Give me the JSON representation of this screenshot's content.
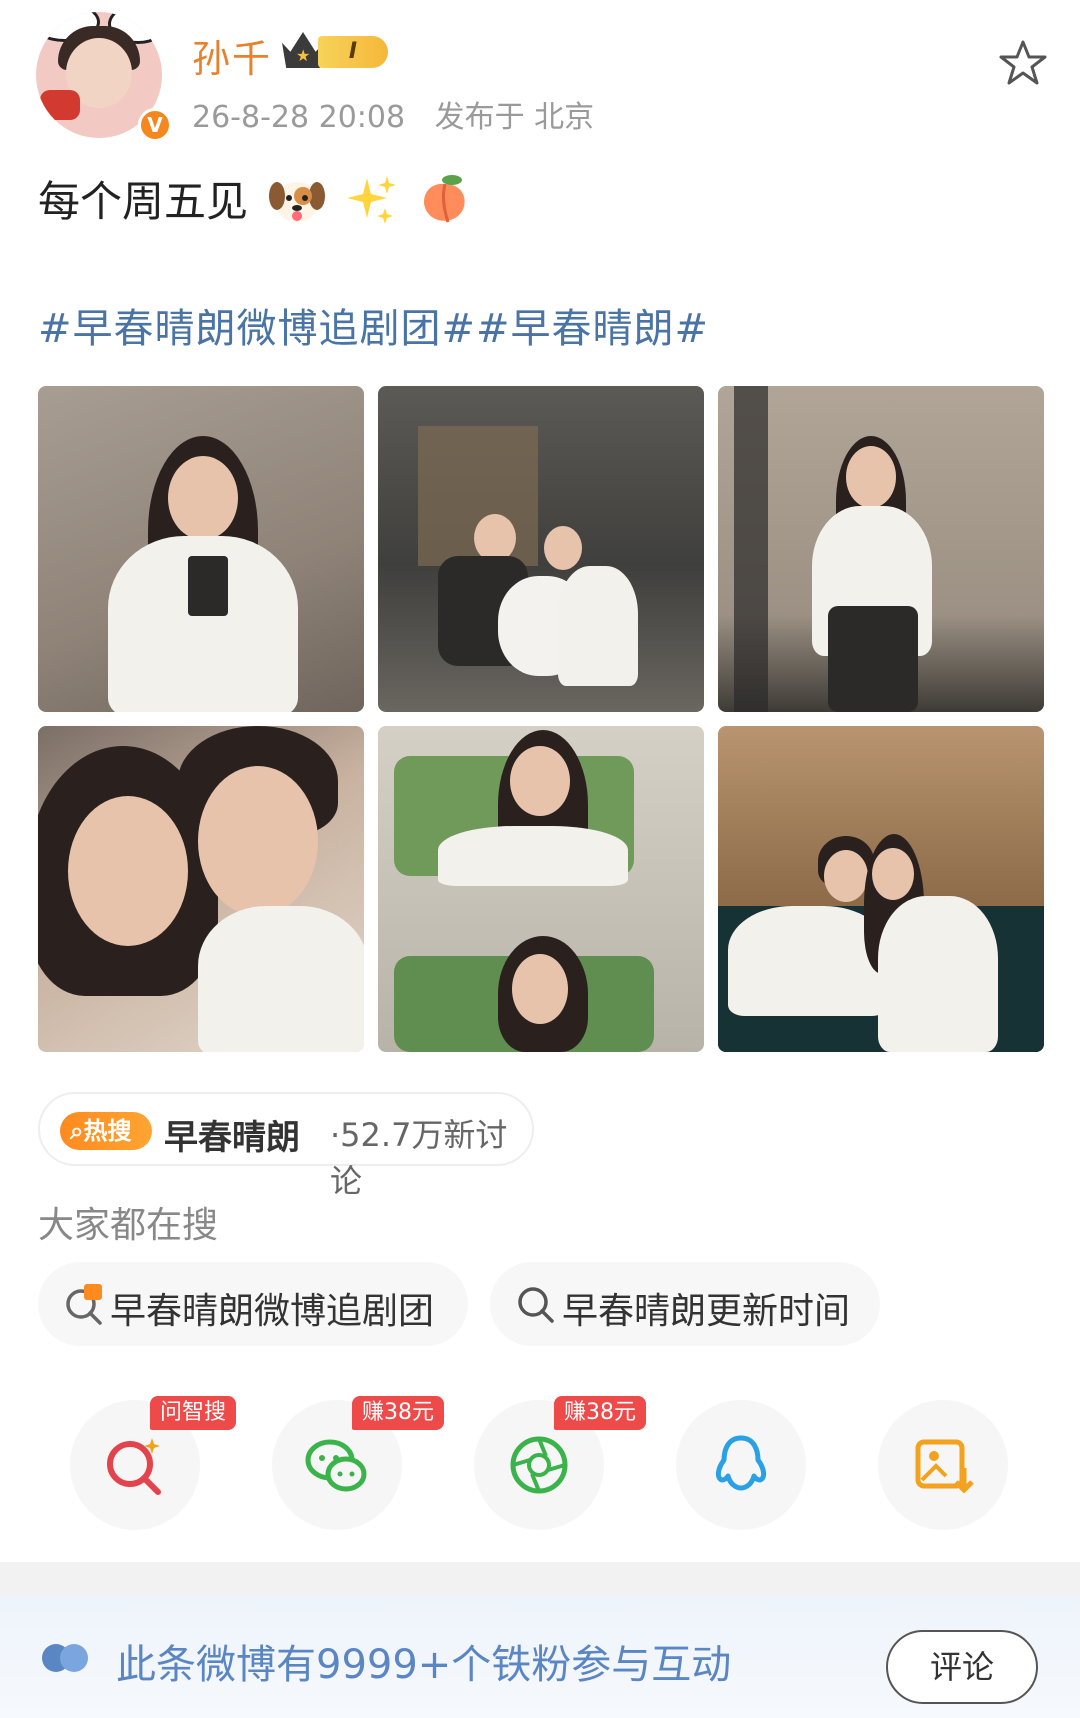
{
  "user": {
    "name": "孙千",
    "level": "I",
    "timestamp": "26-8-28 20:08",
    "location": "发布于 北京"
  },
  "post": {
    "text": "每个周五见",
    "emojis": [
      "dog-face-emoji",
      "sparkles-emoji",
      "peach-emoji"
    ],
    "hashtags": "#早春晴朗微博追剧团##早春晴朗#"
  },
  "photos": [
    {
      "name": "photo-woman-white-shirt"
    },
    {
      "name": "photo-couple-with-dog"
    },
    {
      "name": "photo-woman-standing"
    },
    {
      "name": "photo-couple-selfie"
    },
    {
      "name": "photo-woman-in-car"
    },
    {
      "name": "photo-couple-embrace"
    }
  ],
  "hot_search": {
    "tag": "热搜",
    "label": "早春晴朗",
    "count": "·52.7万新讨论"
  },
  "all_search": {
    "title": "大家都在搜",
    "items": [
      "早春晴朗微博追剧团",
      "早春晴朗更新时间"
    ]
  },
  "share": {
    "badges": [
      "问智搜",
      "赚38元",
      "赚38元"
    ],
    "icons": [
      "ai-search-icon",
      "wechat-icon",
      "moments-icon",
      "qq-icon",
      "save-image-icon"
    ]
  },
  "footer": {
    "text": "此条微博有9999+个铁粉参与互动",
    "comment_label": "评论"
  },
  "colors": {
    "username": "#e8812c",
    "hashtag": "#4a74a6",
    "hot_tag": "#ff8a1f",
    "badge": "#ef4a4a",
    "footer_text": "#5a86c4"
  }
}
